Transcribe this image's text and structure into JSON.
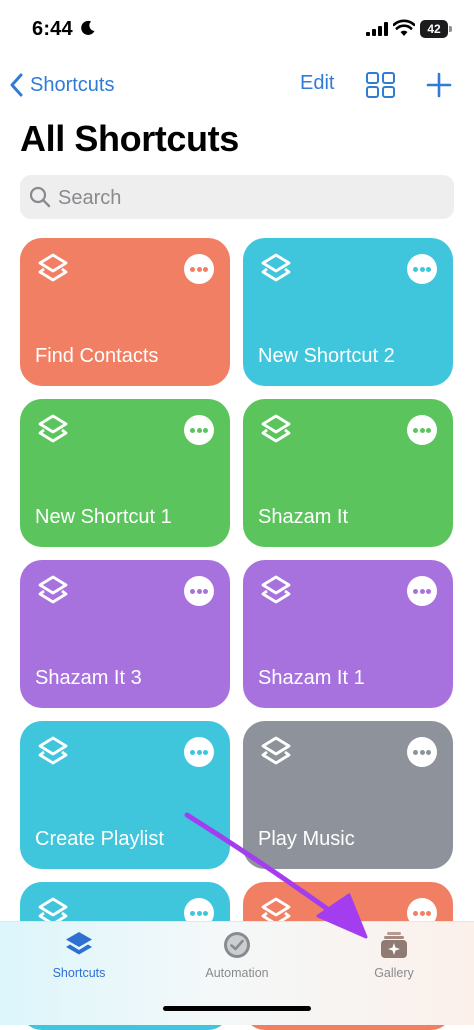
{
  "status_bar": {
    "time": "6:44",
    "battery": "42"
  },
  "nav": {
    "back_label": "Shortcuts",
    "edit_label": "Edit"
  },
  "page_title": "All Shortcuts",
  "search": {
    "placeholder": "Search"
  },
  "shortcuts": [
    {
      "name": "Find Contacts",
      "color": "#f07f64"
    },
    {
      "name": "New Shortcut 2",
      "color": "#3fc5dc"
    },
    {
      "name": "New Shortcut 1",
      "color": "#5cc45c"
    },
    {
      "name": "Shazam It",
      "color": "#5cc45c"
    },
    {
      "name": "Shazam It 3",
      "color": "#a872de"
    },
    {
      "name": "Shazam It 1",
      "color": "#a872de"
    },
    {
      "name": "Create Playlist",
      "color": "#3fc5dc"
    },
    {
      "name": "Play Music",
      "color": "#8e939b"
    },
    {
      "name": "",
      "color": "#3fc5dc"
    },
    {
      "name": "",
      "color": "#f07f64"
    }
  ],
  "tabs": [
    {
      "label": "Shortcuts",
      "icon": "layers-icon",
      "active": true,
      "color": "#2f6fd1"
    },
    {
      "label": "Automation",
      "icon": "clock-icon",
      "active": false,
      "color": "#8a8a8e"
    },
    {
      "label": "Gallery",
      "icon": "gallery-icon",
      "active": false,
      "color": "#8a8a8e"
    }
  ],
  "colors": {
    "accent": "#2f7bd6",
    "annotation_arrow": "#a43df0"
  }
}
